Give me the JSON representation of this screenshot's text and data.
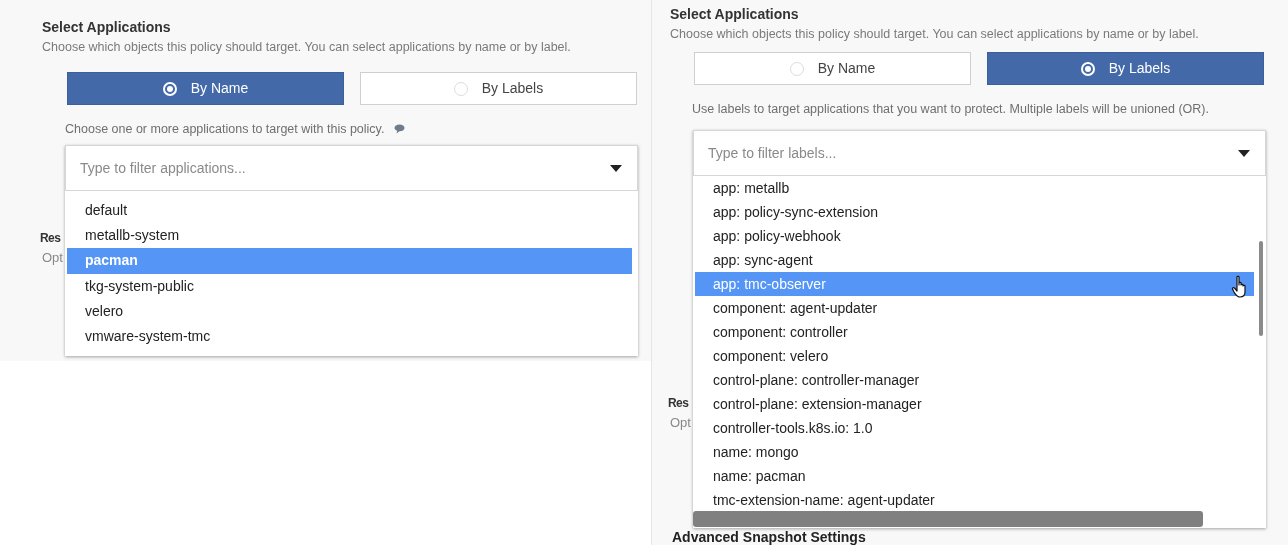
{
  "panels": [
    {
      "title": "Select Applications",
      "description": "Choose which objects this policy should target. You can select applications by name or by label.",
      "options": [
        {
          "label": "By Name",
          "selected": true
        },
        {
          "label": "By Labels",
          "selected": false
        }
      ],
      "hint": "Choose one or more applications to target with this policy.",
      "hint_icon": true,
      "filter": {
        "placeholder": "Type to filter applications..."
      },
      "covered_texts": [
        "Res",
        "Opt"
      ],
      "items": [
        {
          "label": "default",
          "selected": false
        },
        {
          "label": "metallb-system",
          "selected": false
        },
        {
          "label": "pacman",
          "selected": true
        },
        {
          "label": "tkg-system-public",
          "selected": false
        },
        {
          "label": "velero",
          "selected": false
        },
        {
          "label": "vmware-system-tmc",
          "selected": false
        }
      ]
    },
    {
      "title": "Select Applications",
      "description": "Choose which objects this policy should target. You can select applications by name or by label.",
      "options": [
        {
          "label": "By Name",
          "selected": false
        },
        {
          "label": "By Labels",
          "selected": true
        }
      ],
      "hint": "Use labels to target applications that you want to protect. Multiple labels will be unioned (OR).",
      "hint_icon": false,
      "filter": {
        "placeholder": "Type to filter labels..."
      },
      "covered_texts": [
        "Res",
        "Opt"
      ],
      "footer_heading": "Advanced Snapshot Settings",
      "items": [
        {
          "label": "app: metallb",
          "selected": false
        },
        {
          "label": "app: policy-sync-extension",
          "selected": false
        },
        {
          "label": "app: policy-webhook",
          "selected": false
        },
        {
          "label": "app: sync-agent",
          "selected": false
        },
        {
          "label": "app: tmc-observer",
          "selected": true
        },
        {
          "label": "component: agent-updater",
          "selected": false
        },
        {
          "label": "component: controller",
          "selected": false
        },
        {
          "label": "component: velero",
          "selected": false
        },
        {
          "label": "control-plane: controller-manager",
          "selected": false
        },
        {
          "label": "control-plane: extension-manager",
          "selected": false
        },
        {
          "label": "controller-tools.k8s.io: 1.0",
          "selected": false
        },
        {
          "label": "name: mongo",
          "selected": false
        },
        {
          "label": "name: pacman",
          "selected": false
        },
        {
          "label": "tmc-extension-name: agent-updater",
          "selected": false
        }
      ]
    }
  ]
}
